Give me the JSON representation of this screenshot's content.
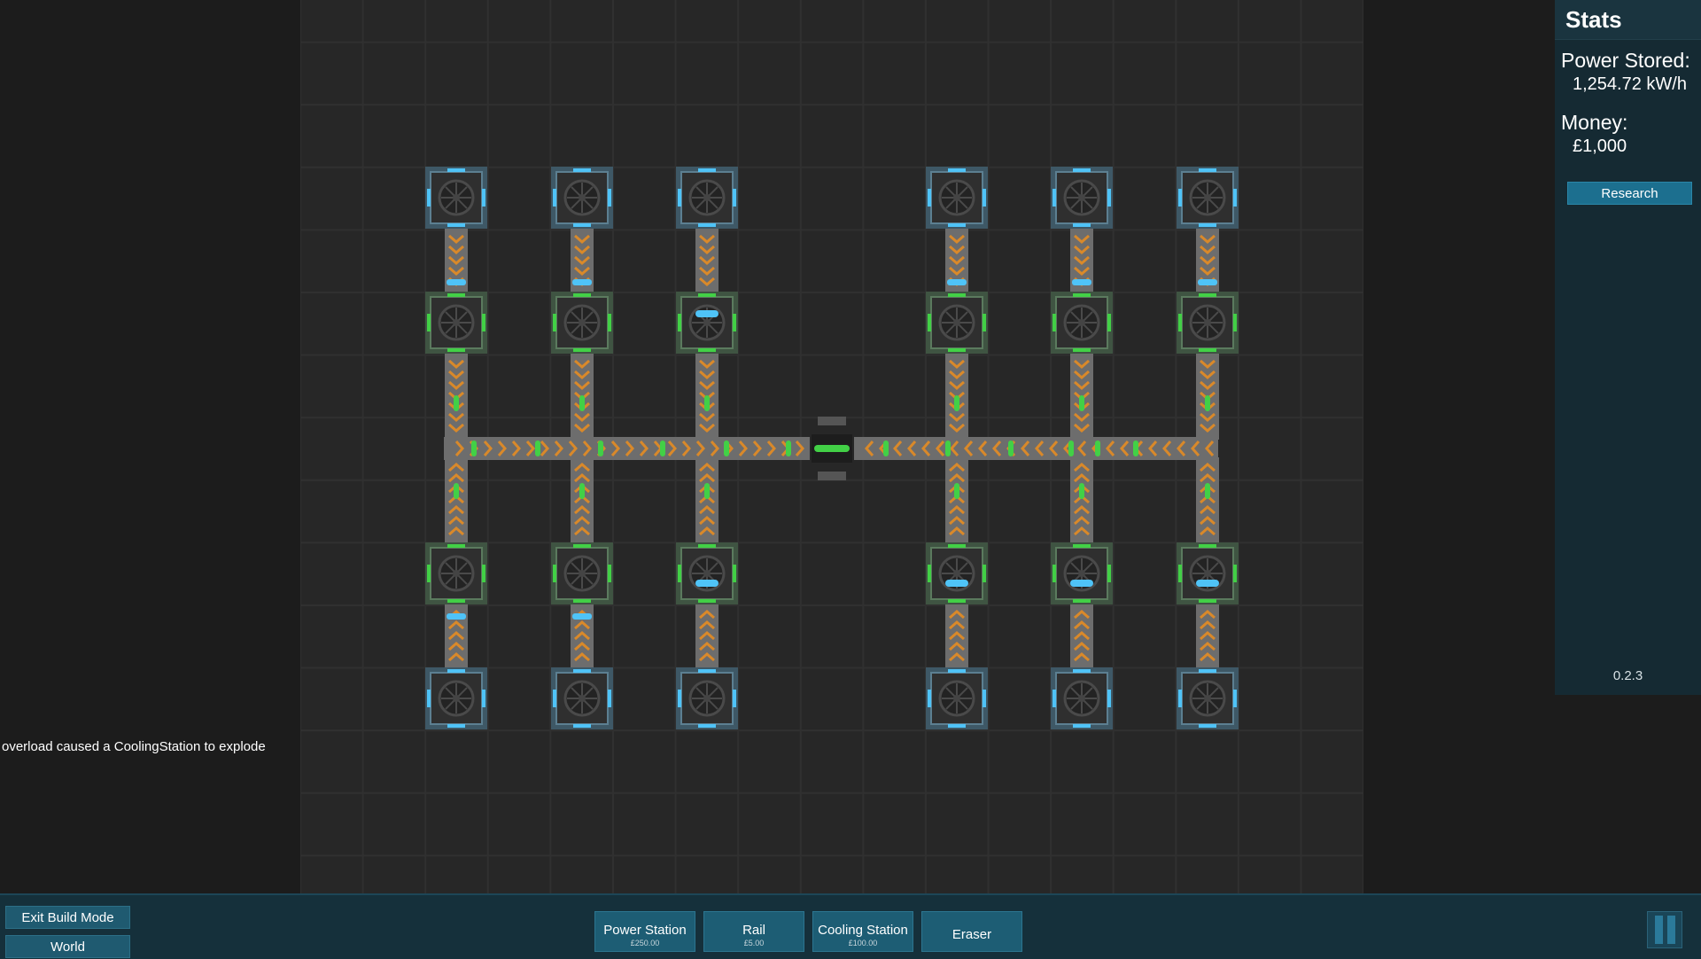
{
  "stats": {
    "title": "Stats",
    "power_label": "Power Stored:",
    "power_value": "1,254.72 kW/h",
    "money_label": "Money:",
    "money_value": "£1,000",
    "research_label": "Research",
    "version": "0.2.3"
  },
  "log_message": "overload caused a CoolingStation to explode",
  "left_buttons": {
    "exit_build": "Exit Build Mode",
    "world": "World"
  },
  "tools": [
    {
      "name": "Power Station",
      "price": "£250.00"
    },
    {
      "name": "Rail",
      "price": "£5.00"
    },
    {
      "name": "Cooling Station",
      "price": "£100.00"
    },
    {
      "name": "Eraser",
      "price": ""
    }
  ],
  "colors": {
    "background": "#1c1c1c",
    "grid": "#272727",
    "panel": "#152a33",
    "button": "#1d5d74",
    "cooling_accent": "#4fc3f7",
    "power_accent": "#42d046",
    "rail_arrow": "#d9892a"
  },
  "icons": {
    "cooling_station": "fan-icon",
    "power_station": "fan-icon",
    "pause": "pause-icon"
  }
}
